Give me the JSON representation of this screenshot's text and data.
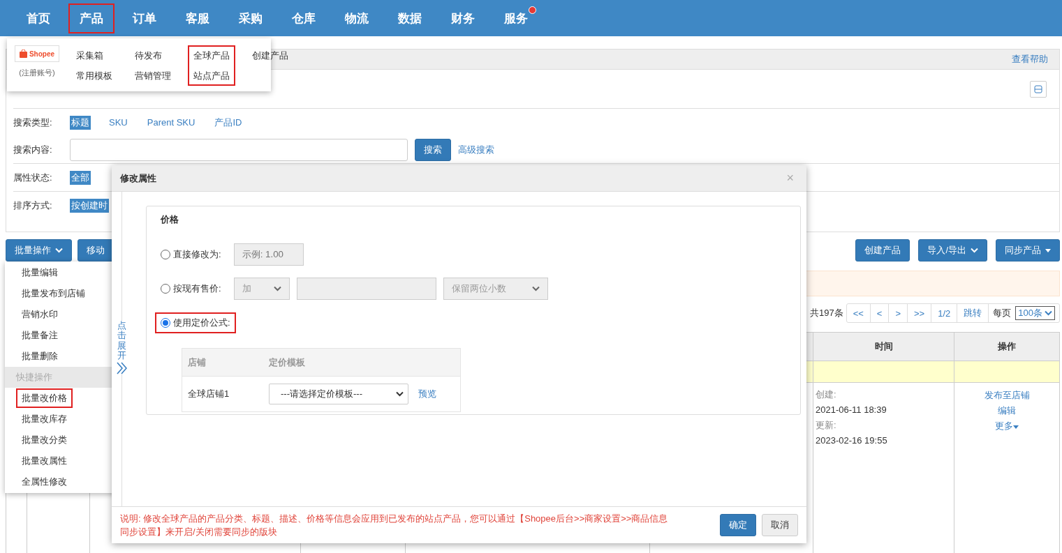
{
  "nav": {
    "items": [
      {
        "label": "首页",
        "selected": false,
        "dot": false
      },
      {
        "label": "产品",
        "selected": true,
        "dot": false
      },
      {
        "label": "订单",
        "selected": false,
        "dot": false
      },
      {
        "label": "客服",
        "selected": false,
        "dot": false
      },
      {
        "label": "采购",
        "selected": false,
        "dot": false
      },
      {
        "label": "仓库",
        "selected": false,
        "dot": false
      },
      {
        "label": "物流",
        "selected": false,
        "dot": false
      },
      {
        "label": "数据",
        "selected": false,
        "dot": false
      },
      {
        "label": "财务",
        "selected": false,
        "dot": false
      },
      {
        "label": "服务",
        "selected": false,
        "dot": true
      }
    ]
  },
  "product_menu": {
    "platform": "Shopee",
    "account_note": "(注册账号)",
    "columns": [
      {
        "items": [
          "采集箱",
          "常用模板"
        ],
        "highlighted": false
      },
      {
        "items": [
          "待发布",
          "营销管理"
        ],
        "highlighted": false
      },
      {
        "items": [
          "全球产品",
          "站点产品"
        ],
        "highlighted": true
      },
      {
        "items": [
          "创建产品"
        ],
        "highlighted": false
      }
    ]
  },
  "help_link": "查看帮助",
  "filters": [
    {
      "label": "搜索类型:",
      "kind": "options",
      "options": [
        {
          "label": "标题",
          "selected": true
        },
        {
          "label": "SKU",
          "selected": false
        },
        {
          "label": "Parent SKU",
          "selected": false
        },
        {
          "label": "产品ID",
          "selected": false
        }
      ]
    },
    {
      "label": "搜索内容:",
      "kind": "search",
      "button": "搜索",
      "link": "高级搜索"
    },
    {
      "label": "属性状态:",
      "kind": "options",
      "options": [
        {
          "label": "全部",
          "selected": true
        }
      ]
    },
    {
      "label": "排序方式:",
      "kind": "options",
      "options": [
        {
          "label": "按创建时",
          "selected": true
        }
      ]
    }
  ],
  "toolbar": {
    "left": [
      {
        "label": "批量操作",
        "kind": "dropdown"
      },
      {
        "label": "移动",
        "kind": "plain"
      }
    ],
    "right": [
      {
        "label": "创建产品",
        "kind": "plain"
      },
      {
        "label": "导入/导出",
        "kind": "dropdown"
      },
      {
        "label": "同步产品",
        "kind": "split"
      }
    ]
  },
  "pagination": {
    "total": "共197条",
    "buttons": [
      "<<",
      "<",
      ">",
      ">>",
      "1/2",
      "跳转"
    ],
    "per_page_label": "每页",
    "per_page": "100条"
  },
  "table": {
    "columns": [
      "时间",
      "操作"
    ],
    "row": {
      "created_label": "创建:",
      "created": "2021-06-11 18:39",
      "updated_label": "更新:",
      "updated": "2023-02-16 19:55",
      "actions": [
        "发布至店铺",
        "编辑",
        "更多"
      ]
    }
  },
  "batch_menu": [
    {
      "label": "批量编辑",
      "kind": "item",
      "highlighted": false
    },
    {
      "label": "批量发布到店铺",
      "kind": "item",
      "highlighted": false
    },
    {
      "label": "营销水印",
      "kind": "item",
      "highlighted": false
    },
    {
      "label": "批量备注",
      "kind": "item",
      "highlighted": false
    },
    {
      "label": "批量删除",
      "kind": "item",
      "highlighted": false
    },
    {
      "label": "快捷操作",
      "kind": "header"
    },
    {
      "label": "批量改价格",
      "kind": "item",
      "highlighted": true
    },
    {
      "label": "批量改库存",
      "kind": "item",
      "highlighted": false
    },
    {
      "label": "批量改分类",
      "kind": "item",
      "highlighted": false
    },
    {
      "label": "批量改属性",
      "kind": "item",
      "highlighted": false
    },
    {
      "label": "全属性修改",
      "kind": "item",
      "highlighted": false
    }
  ],
  "dialog": {
    "title": "修改属性",
    "close": "×",
    "expand_label": "点击展开",
    "section": "价格",
    "options": [
      {
        "label": "直接修改为:",
        "kind": "value",
        "selected": false,
        "highlighted": false,
        "placeholder": "示例: 1.00"
      },
      {
        "label": "按现有售价:",
        "kind": "adjust",
        "selected": false,
        "highlighted": false,
        "operator": "加",
        "rounding": "保留两位小数"
      },
      {
        "label": "使用定价公式:",
        "kind": "formula",
        "selected": true,
        "highlighted": true
      }
    ],
    "formula_table": {
      "columns": [
        "店铺",
        "定价模板"
      ],
      "rows": [
        {
          "shop": "全球店铺1",
          "template": "---请选择定价模板---",
          "link": "预览"
        }
      ]
    },
    "note": "说明: 修改全球产品的产品分类、标题、描述、价格等信息会应用到已发布的站点产品，您可以通过【Shopee后台>>商家设置>>商品信息同步设置】来开启/关闭需要同步的版块",
    "buttons": [
      {
        "label": "确定",
        "primary": true
      },
      {
        "label": "取消",
        "primary": false
      }
    ]
  }
}
